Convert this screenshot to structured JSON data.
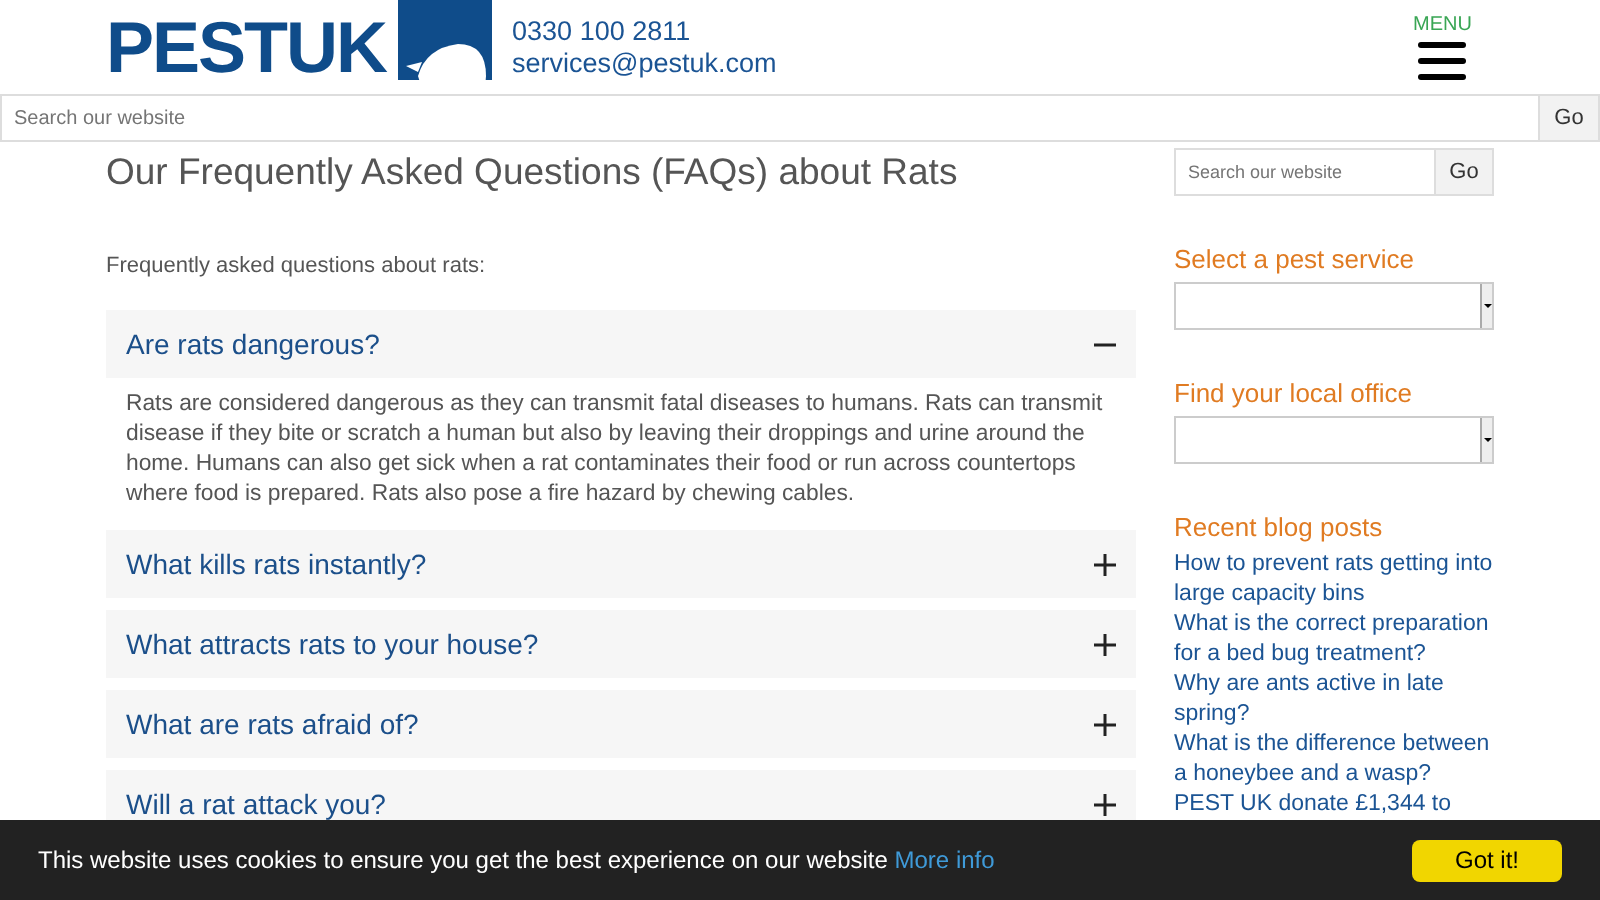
{
  "header": {
    "logo": "PESTUK",
    "phone": "0330 100 2811",
    "email": "services@pestuk.com",
    "menu_label": "MENU"
  },
  "top_search": {
    "placeholder": "Search our website",
    "button": "Go"
  },
  "page_title": "Our Frequently Asked Questions (FAQs) about Rats",
  "intro": "Frequently asked questions about rats:",
  "faqs": [
    {
      "question": "Are rats dangerous?",
      "expanded": true,
      "answer": "Rats are considered dangerous as they can transmit fatal diseases to humans. Rats can transmit disease if they bite or scratch a human but also by leaving their droppings and urine around the home. Humans can also get sick when a rat contaminates their food or run across countertops where food is prepared. Rats also pose a fire hazard by chewing cables."
    },
    {
      "question": "What kills rats instantly?",
      "expanded": false
    },
    {
      "question": "What attracts rats to your house?",
      "expanded": false
    },
    {
      "question": "What are rats afraid of?",
      "expanded": false
    },
    {
      "question": "Will a rat attack you?",
      "expanded": false
    }
  ],
  "sidebar": {
    "search": {
      "placeholder": "Search our website",
      "button": "Go"
    },
    "pest_service": {
      "heading": "Select a pest service"
    },
    "local_office": {
      "heading": "Find your local office"
    },
    "blog": {
      "heading": "Recent blog posts",
      "posts": [
        "How to prevent rats getting into large capacity bins",
        "What is the correct preparation for a bed bug treatment?",
        "Why are ants active in late spring?",
        "What is the difference between a honeybee and a wasp?",
        "PEST UK donate £1,344 to"
      ]
    }
  },
  "cookie_bar": {
    "message": "This website uses cookies to ensure you get the best experience on our website",
    "link": "More info",
    "button": "Got it!"
  }
}
